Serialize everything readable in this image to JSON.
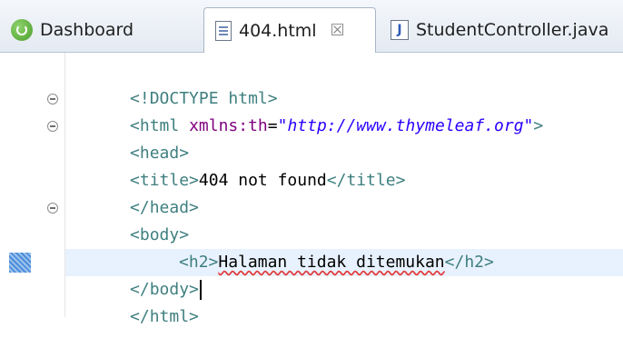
{
  "tabs": [
    {
      "label": "Dashboard",
      "icon": "spring-icon"
    },
    {
      "label": "404.html",
      "icon": "html-file-icon",
      "close": "☒"
    },
    {
      "label": "StudentController.java",
      "icon": "java-file-icon"
    }
  ],
  "editor": {
    "lines": [
      {
        "parts": [
          "<!DOCTYPE html>"
        ]
      },
      {
        "parts": [
          "<html ",
          "xmlns:th",
          "=",
          "\"http://www.thymeleaf.org\"",
          ">"
        ]
      },
      {
        "parts": [
          "<head>"
        ]
      },
      {
        "parts": [
          "<title>",
          "404 not found",
          "</title>"
        ]
      },
      {
        "parts": [
          "</head>"
        ]
      },
      {
        "parts": [
          "<body>"
        ]
      },
      {
        "parts": [
          "<h2>",
          "Halaman tidak ditemukan",
          "</h2>"
        ]
      },
      {
        "parts": [
          "</body>"
        ]
      },
      {
        "parts": [
          "</html>"
        ]
      }
    ]
  },
  "colors": {
    "tag": "#3f7f7f",
    "attribute": "#7f007f",
    "string": "#2a00ff",
    "text": "#000000",
    "current_line": "#e8f2fe",
    "spell_underline": "#e23d3d"
  }
}
